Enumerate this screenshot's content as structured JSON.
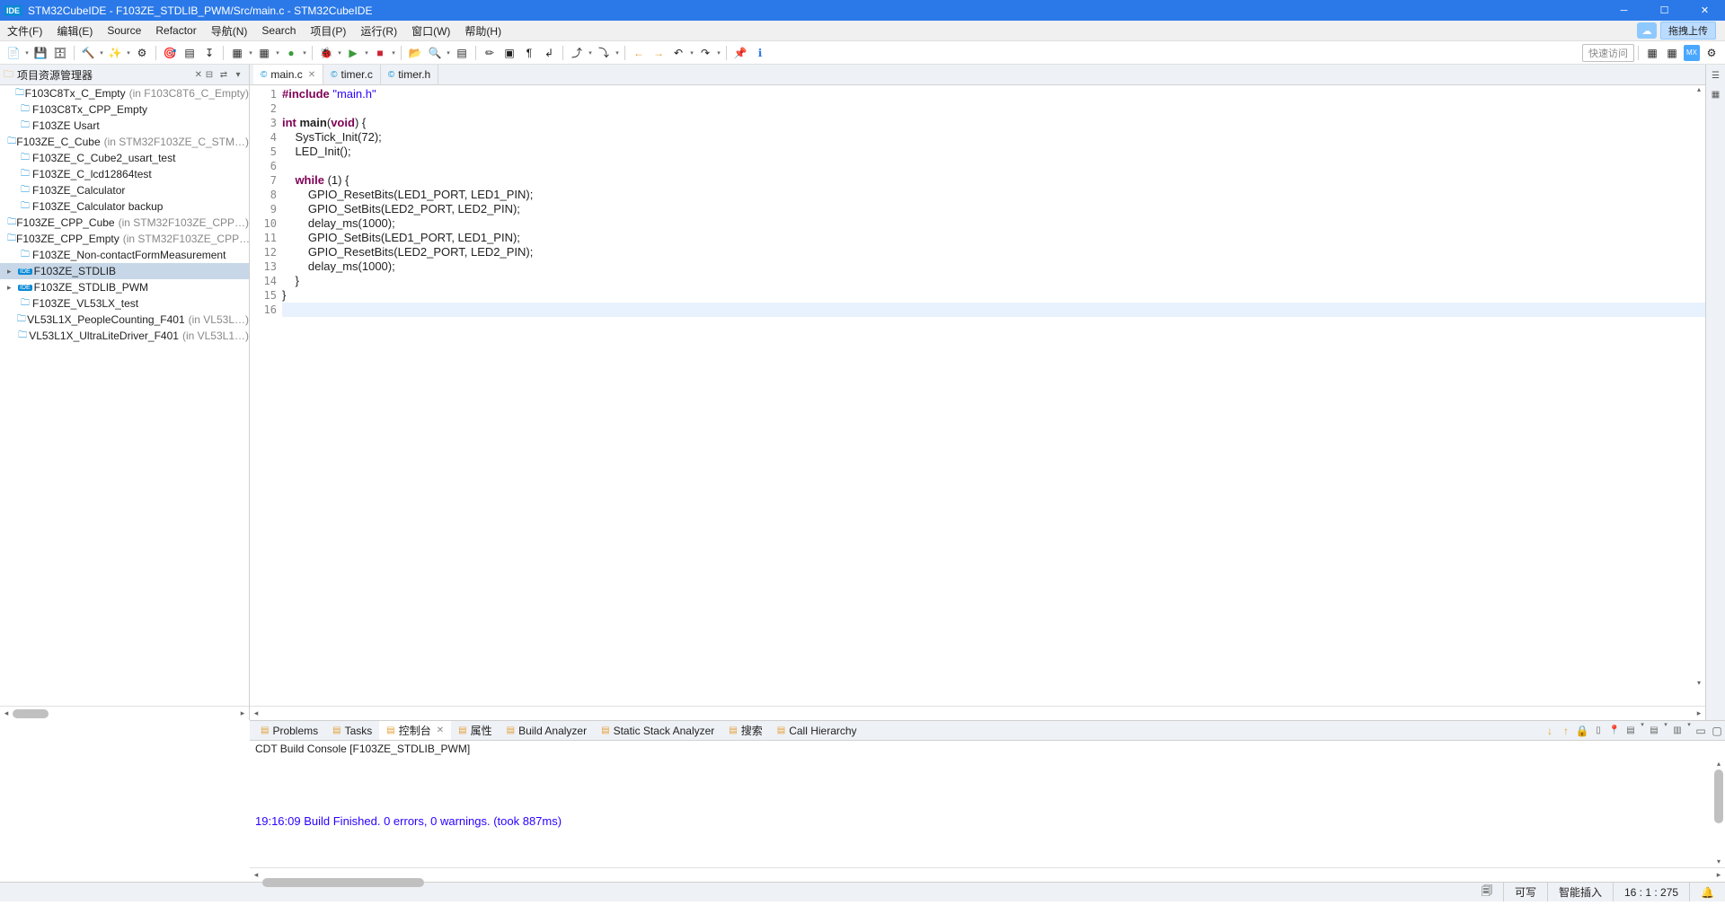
{
  "window": {
    "title": "STM32CubeIDE - F103ZE_STDLIB_PWM/Src/main.c - STM32CubeIDE"
  },
  "menu": {
    "items": [
      "文件(F)",
      "编辑(E)",
      "Source",
      "Refactor",
      "导航(N)",
      "Search",
      "项目(P)",
      "运行(R)",
      "窗口(W)",
      "帮助(H)"
    ],
    "upload_label": "拖拽上传"
  },
  "toolbar": {
    "quick_access": "快速访问"
  },
  "sidebar": {
    "title": "项目资源管理器",
    "items": [
      {
        "label": "F103C8Tx_C_Empty",
        "hint": "(in F103C8T6_C_Empty)",
        "expand": false
      },
      {
        "label": "F103C8Tx_CPP_Empty",
        "expand": false
      },
      {
        "label": "F103ZE Usart",
        "expand": false
      },
      {
        "label": "F103ZE_C_Cube",
        "hint": "(in STM32F103ZE_C_STM…)",
        "expand": false
      },
      {
        "label": "F103ZE_C_Cube2_usart_test",
        "expand": false
      },
      {
        "label": "F103ZE_C_lcd12864test",
        "expand": false
      },
      {
        "label": "F103ZE_Calculator",
        "expand": false
      },
      {
        "label": "F103ZE_Calculator backup",
        "expand": false
      },
      {
        "label": "F103ZE_CPP_Cube",
        "hint": "(in STM32F103ZE_CPP…)",
        "expand": false
      },
      {
        "label": "F103ZE_CPP_Empty",
        "hint": "(in STM32F103ZE_CPP…)",
        "expand": false
      },
      {
        "label": "F103ZE_Non-contactFormMeasurement",
        "expand": false
      },
      {
        "label": "F103ZE_STDLIB",
        "expand": true,
        "selected": true,
        "ide": true
      },
      {
        "label": "F103ZE_STDLIB_PWM",
        "expand": true,
        "ide": true
      },
      {
        "label": "F103ZE_VL53LX_test",
        "expand": false
      },
      {
        "label": "VL53L1X_PeopleCounting_F401",
        "hint": "(in VL53L…)",
        "expand": false
      },
      {
        "label": "VL53L1X_UltraLiteDriver_F401",
        "hint": "(in VL53L1…)",
        "expand": false
      }
    ]
  },
  "editor": {
    "tabs": [
      {
        "label": "main.c",
        "active": true
      },
      {
        "label": "timer.c"
      },
      {
        "label": "timer.h"
      }
    ],
    "lines": [
      {
        "n": 1,
        "include": "#include",
        "str": " \"main.h\""
      },
      {
        "n": 2,
        "plain": ""
      },
      {
        "n": 3,
        "int_main": true
      },
      {
        "n": 4,
        "plain": "    SysTick_Init(72);"
      },
      {
        "n": 5,
        "plain": "    LED_Init();"
      },
      {
        "n": 6,
        "plain": ""
      },
      {
        "n": 7,
        "while_line": true
      },
      {
        "n": 8,
        "plain": "        GPIO_ResetBits(LED1_PORT, LED1_PIN);"
      },
      {
        "n": 9,
        "plain": "        GPIO_SetBits(LED2_PORT, LED2_PIN);"
      },
      {
        "n": 10,
        "plain": "        delay_ms(1000);"
      },
      {
        "n": 11,
        "plain": "        GPIO_SetBits(LED1_PORT, LED1_PIN);"
      },
      {
        "n": 12,
        "plain": "        GPIO_ResetBits(LED2_PORT, LED2_PIN);"
      },
      {
        "n": 13,
        "plain": "        delay_ms(1000);"
      },
      {
        "n": 14,
        "plain": "    }"
      },
      {
        "n": 15,
        "plain": "}"
      },
      {
        "n": 16,
        "plain": "",
        "sel": true
      }
    ],
    "int_kw": "int",
    "main_fn": " main",
    "main_paren_open": "(",
    "void_kw": "void",
    "main_rest": ") {",
    "while_kw": "    while",
    "while_rest": " (1) {"
  },
  "bottom": {
    "tabs": [
      {
        "label": "Problems"
      },
      {
        "label": "Tasks"
      },
      {
        "label": "控制台",
        "active": true
      },
      {
        "label": "属性"
      },
      {
        "label": "Build Analyzer"
      },
      {
        "label": "Static Stack Analyzer"
      },
      {
        "label": "搜索"
      },
      {
        "label": "Call Hierarchy"
      }
    ],
    "header": "CDT Build Console [F103ZE_STDLIB_PWM]",
    "line": "19:16:09 Build Finished. 0 errors, 0 warnings. (took 887ms)"
  },
  "status": {
    "writable": "可写",
    "insert": "智能插入",
    "pos": "16 : 1 : 275"
  }
}
